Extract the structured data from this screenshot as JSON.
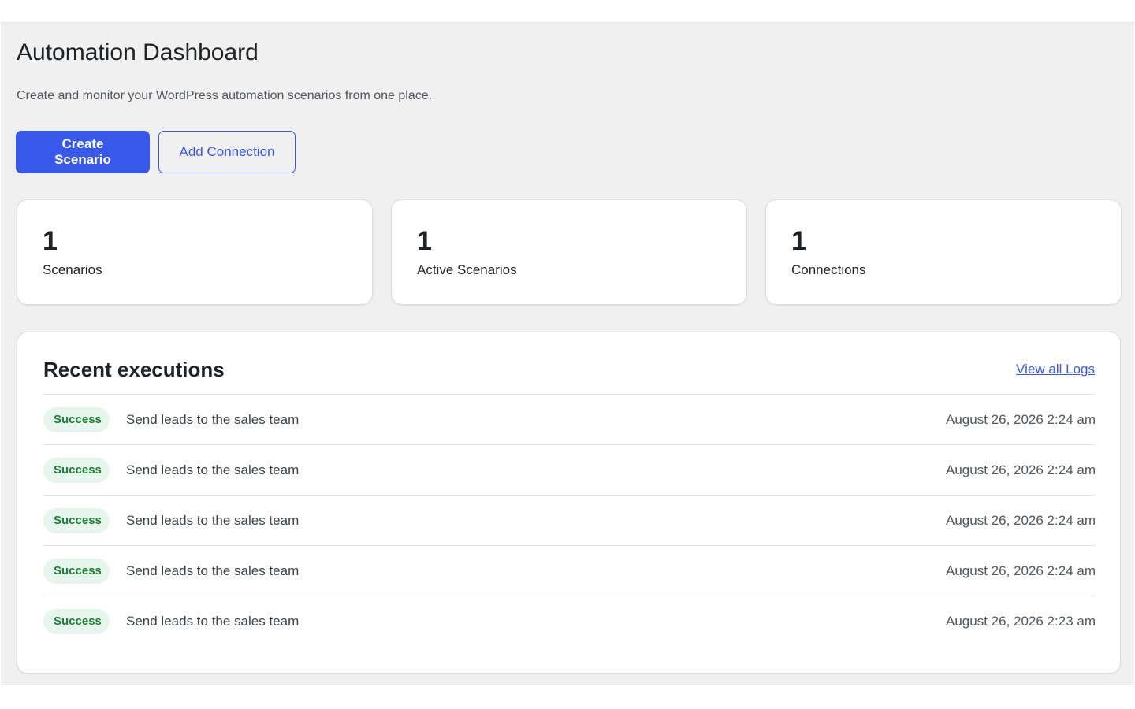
{
  "header": {
    "title": "Automation Dashboard",
    "subtitle": "Create and monitor your WordPress automation scenarios from one place."
  },
  "actions": {
    "create_label": "Create Scenario",
    "add_connection_label": "Add Connection"
  },
  "stats": [
    {
      "value": "1",
      "label": "Scenarios"
    },
    {
      "value": "1",
      "label": "Active Scenarios"
    },
    {
      "value": "1",
      "label": "Connections"
    }
  ],
  "executions": {
    "title": "Recent executions",
    "view_all_label": "View all Logs",
    "rows": [
      {
        "status": "Success",
        "name": "Send leads to the sales team",
        "time": "August 26, 2026 2:24 am"
      },
      {
        "status": "Success",
        "name": "Send leads to the sales team",
        "time": "August 26, 2026 2:24 am"
      },
      {
        "status": "Success",
        "name": "Send leads to the sales team",
        "time": "August 26, 2026 2:24 am"
      },
      {
        "status": "Success",
        "name": "Send leads to the sales team",
        "time": "August 26, 2026 2:24 am"
      },
      {
        "status": "Success",
        "name": "Send leads to the sales team",
        "time": "August 26, 2026 2:23 am"
      }
    ]
  },
  "colors": {
    "accent": "#3858e9",
    "success_bg": "#e7f6ec",
    "success_text": "#1a7f37",
    "page_bg": "#f0f0f1"
  }
}
